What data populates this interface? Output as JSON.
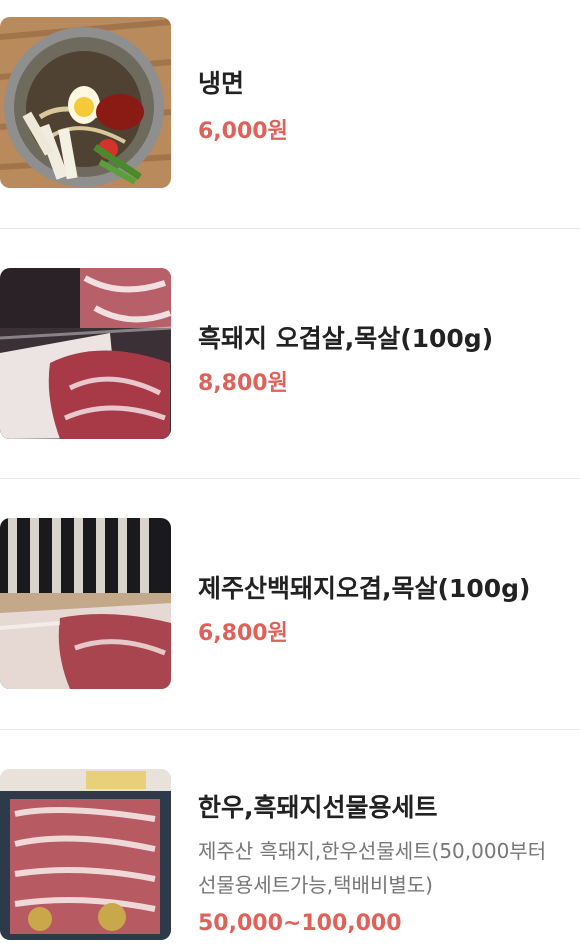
{
  "items": [
    {
      "name": "냉면",
      "price": "6,000원",
      "image": "naengmyeon-photo"
    },
    {
      "name": "흑돼지 오겹살,목살(100g)",
      "price": "8,800원",
      "image": "black-pork-photo"
    },
    {
      "name": "제주산백돼지오겹,목살(100g)",
      "price": "6,800원",
      "image": "white-pork-photo"
    },
    {
      "name": "한우,흑돼지선물용세트",
      "description_line1": "제주산 흑돼지,한우선물세트(50,000부터",
      "description_line2": "선물용세트가능,택배비별도)",
      "price": "50,000~100,000",
      "image": "gift-set-photo"
    }
  ]
}
